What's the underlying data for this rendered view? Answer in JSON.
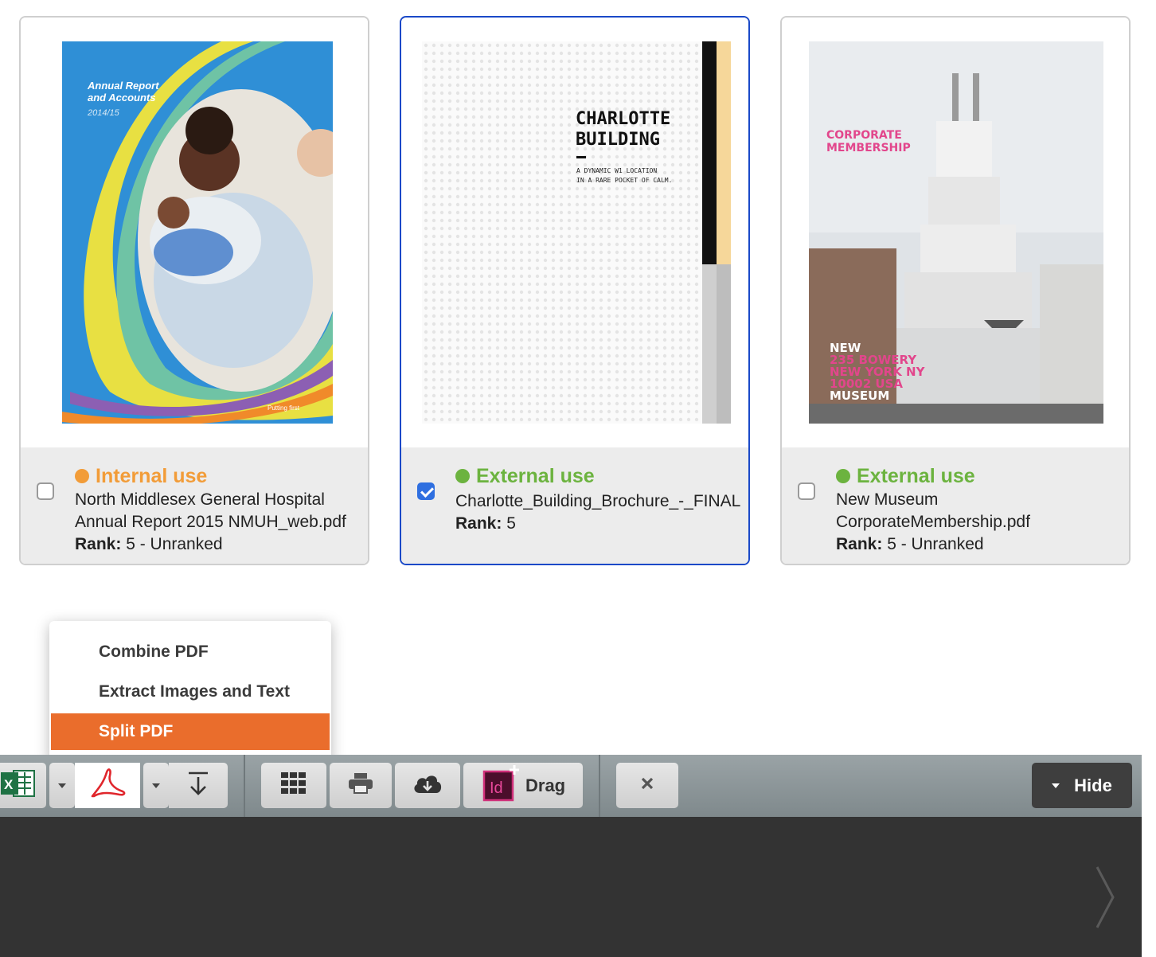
{
  "cards": [
    {
      "usage": "Internal use",
      "usage_color": "#f29c38",
      "filename": "North Middlesex General Hospital Annual Report 2015 NMUH_web.pdf",
      "rank_label": "Rank:",
      "rank_value": "5 - Unranked",
      "checked": false,
      "thumb_text": {
        "line1": "Annual Report",
        "line2": "and Accounts",
        "line3": "2014/15",
        "footer": "Putting      first"
      }
    },
    {
      "usage": "External use",
      "usage_color": "#6cb33f",
      "filename": "Charlotte_Building_Brochure_-_FINAL",
      "rank_label": "Rank:",
      "rank_value": "5",
      "checked": true,
      "thumb_text": {
        "title1": "CHARLOTTE",
        "title2": "BUILDING",
        "sub1": "A DYNAMIC W1 LOCATION",
        "sub2": "IN A RARE POCKET OF CALM."
      }
    },
    {
      "usage": "External use",
      "usage_color": "#6cb33f",
      "filename": "New Museum\nCorporateMembership.pdf",
      "rank_label": "Rank:",
      "rank_value": "5 - Unranked",
      "checked": false,
      "thumb_text": {
        "title1": "CORPORATE",
        "title2": "MEMBERSHIP",
        "b1": "NEW",
        "b2": "235 BOWERY",
        "b3": "NEW YORK NY",
        "b4": "10002 USA",
        "b5": "MUSEUM"
      }
    }
  ],
  "menu": {
    "items": [
      "Combine PDF",
      "Extract Images and Text",
      "Split PDF"
    ],
    "active_index": 2
  },
  "toolbar": {
    "excel_icon": "excel-icon",
    "pdf_icon": "acrobat-pdf-icon",
    "download_icon": "download-arrow-icon",
    "grid_icon": "grid-icon",
    "print_icon": "printer-icon",
    "cloud_icon": "cloud-download-icon",
    "indesign_label": "Id",
    "drag_label": "Drag",
    "close_icon": "close-icon",
    "hide_label": "Hide"
  },
  "colors": {
    "accent": "#ea6d2c",
    "selected_border": "#1a49c8",
    "checkbox_blue": "#2f6fe0",
    "internal": "#f29c38",
    "external": "#6cb33f"
  }
}
